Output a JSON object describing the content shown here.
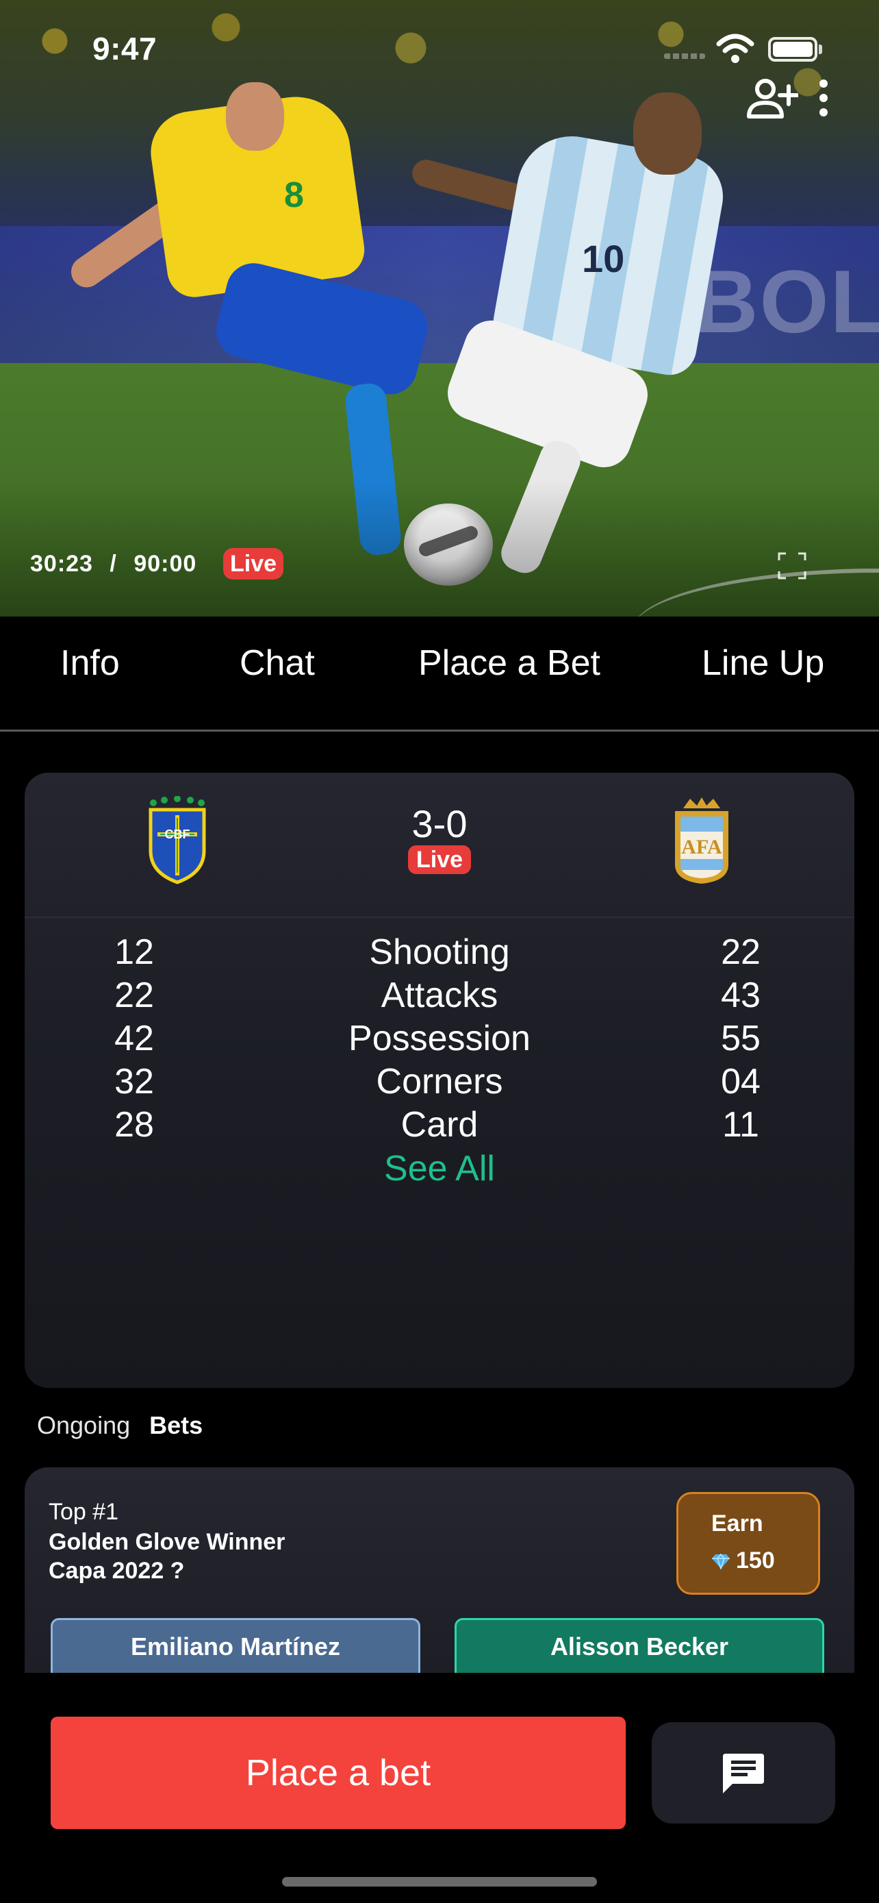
{
  "status_bar": {
    "time": "9:47"
  },
  "video": {
    "elapsed": "30:23",
    "separator": "/",
    "duration": "90:00",
    "live_label": "Live",
    "board_text": "EBOL",
    "player_left_number": "8",
    "player_right_number": "10",
    "icons": [
      "add-user-icon",
      "more-vertical-icon",
      "fullscreen-icon"
    ]
  },
  "tabs": [
    {
      "label": "Info"
    },
    {
      "label": "Chat"
    },
    {
      "label": "Place a Bet"
    },
    {
      "label": "Line Up"
    }
  ],
  "match": {
    "home_crest_text": "CBF",
    "away_crest_text": "AFA",
    "score": "3-0",
    "live_label": "Live",
    "stats": [
      {
        "home": "12",
        "label": "Shooting",
        "away": "22"
      },
      {
        "home": "22",
        "label": "Attacks",
        "away": "43"
      },
      {
        "home": "42",
        "label": "Possession",
        "away": "55"
      },
      {
        "home": "32",
        "label": "Corners",
        "away": "04"
      },
      {
        "home": "28",
        "label": "Card",
        "away": "11"
      }
    ],
    "see_all": "See All"
  },
  "ongoing_bets": {
    "label_light": "Ongoing",
    "label_bold": "Bets",
    "card": {
      "top_label": "Top #1",
      "question_line1": "Golden Glove Winner",
      "question_line2": "Capa 2022 ?",
      "earn_label": "Earn",
      "earn_value": "150",
      "option_a": "Emiliano Martínez",
      "option_b": "Alisson Becker"
    }
  },
  "bottom_bar": {
    "place_bet_label": "Place a bet"
  },
  "colors": {
    "accent_red": "#f4433d",
    "live_red": "#e73c3a",
    "see_all_green": "#1fbf8c",
    "earn_orange": "#d8821f"
  }
}
